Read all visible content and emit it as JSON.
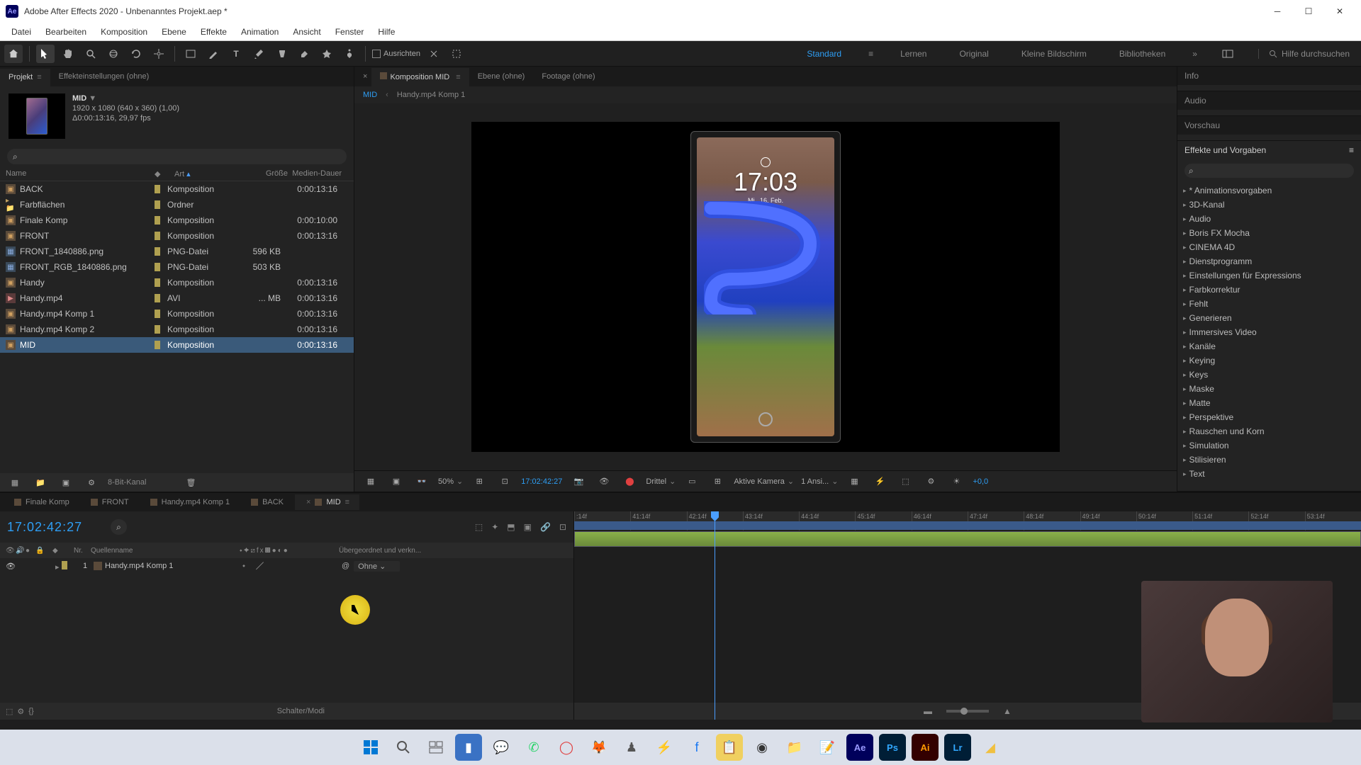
{
  "titlebar": {
    "app": "Ae",
    "title": "Adobe After Effects 2020 - Unbenanntes Projekt.aep *"
  },
  "menu": [
    "Datei",
    "Bearbeiten",
    "Komposition",
    "Ebene",
    "Effekte",
    "Animation",
    "Ansicht",
    "Fenster",
    "Hilfe"
  ],
  "toolbar": {
    "align_label": "Ausrichten",
    "workspaces": [
      "Standard",
      "Lernen",
      "Original",
      "Kleine Bildschirm",
      "Bibliotheken"
    ],
    "search_placeholder": "Hilfe durchsuchen"
  },
  "project_panel": {
    "tab_project": "Projekt",
    "tab_effects": "Effekteinstellungen (ohne)",
    "selected_name": "MID",
    "selected_info1": "1920 x 1080 (640 x 360) (1,00)",
    "selected_info2": "Δ0:00:13:16, 29,97 fps",
    "cols": {
      "name": "Name",
      "art": "Art",
      "size": "Größe",
      "dur": "Medien-Dauer"
    },
    "items": [
      {
        "name": "BACK",
        "kind": "comp",
        "art": "Komposition",
        "size": "",
        "dur": "0:00:13:16"
      },
      {
        "name": "Farbflächen",
        "kind": "folder",
        "art": "Ordner",
        "size": "",
        "dur": ""
      },
      {
        "name": "Finale Komp",
        "kind": "comp",
        "art": "Komposition",
        "size": "",
        "dur": "0:00:10:00"
      },
      {
        "name": "FRONT",
        "kind": "comp",
        "art": "Komposition",
        "size": "",
        "dur": "0:00:13:16"
      },
      {
        "name": "FRONT_1840886.png",
        "kind": "png",
        "art": "PNG-Datei",
        "size": "596 KB",
        "dur": ""
      },
      {
        "name": "FRONT_RGB_1840886.png",
        "kind": "png",
        "art": "PNG-Datei",
        "size": "503 KB",
        "dur": ""
      },
      {
        "name": "Handy",
        "kind": "comp",
        "art": "Komposition",
        "size": "",
        "dur": "0:00:13:16"
      },
      {
        "name": "Handy.mp4",
        "kind": "avi",
        "art": "AVI",
        "size": "... MB",
        "dur": "0:00:13:16"
      },
      {
        "name": "Handy.mp4 Komp 1",
        "kind": "comp",
        "art": "Komposition",
        "size": "",
        "dur": "0:00:13:16"
      },
      {
        "name": "Handy.mp4 Komp 2",
        "kind": "comp",
        "art": "Komposition",
        "size": "",
        "dur": "0:00:13:16"
      },
      {
        "name": "MID",
        "kind": "comp",
        "art": "Komposition",
        "size": "",
        "dur": "0:00:13:16",
        "sel": true
      }
    ],
    "bit_depth": "8-Bit-Kanal"
  },
  "comp_panel": {
    "tab_comp": "Komposition MID",
    "tab_layer": "Ebene (ohne)",
    "tab_footage": "Footage (ohne)",
    "nav_active": "MID",
    "nav_next": "Handy.mp4 Komp 1",
    "phone_time": "17:03",
    "phone_date": "Mi., 16. Feb.",
    "footer": {
      "zoom": "50%",
      "timecode": "17:02:42:27",
      "res": "Drittel",
      "camera": "Aktive Kamera",
      "views": "1 Ansi...",
      "exposure": "+0,0"
    }
  },
  "right": {
    "info": "Info",
    "audio": "Audio",
    "preview": "Vorschau",
    "effects_title": "Effekte und Vorgaben",
    "effects": [
      "* Animationsvorgaben",
      "3D-Kanal",
      "Audio",
      "Boris FX Mocha",
      "CINEMA 4D",
      "Dienstprogramm",
      "Einstellungen für Expressions",
      "Farbkorrektur",
      "Fehlt",
      "Generieren",
      "Immersives Video",
      "Kanäle",
      "Keying",
      "Keys",
      "Maske",
      "Matte",
      "Perspektive",
      "Rauschen und Korn",
      "Simulation",
      "Stilisieren",
      "Text"
    ]
  },
  "timeline": {
    "tabs": [
      {
        "label": "Finale Komp"
      },
      {
        "label": "FRONT"
      },
      {
        "label": "Handy.mp4 Komp 1"
      },
      {
        "label": "BACK"
      },
      {
        "label": "MID",
        "active": true
      }
    ],
    "timecode": "17:02:42:27",
    "col_nr": "Nr.",
    "col_source": "Quellenname",
    "col_parent": "Übergeordnet und verkn...",
    "ticks": [
      ":14f",
      "41:14f",
      "42:14f",
      "43:14f",
      "44:14f",
      "45:14f",
      "46:14f",
      "47:14f",
      "48:14f",
      "49:14f",
      "50:14f",
      "51:14f",
      "52:14f",
      "53:14f"
    ],
    "layer": {
      "num": "1",
      "name": "Handy.mp4 Komp 1",
      "parent": "Ohne"
    },
    "footer_label": "Schalter/Modi"
  }
}
